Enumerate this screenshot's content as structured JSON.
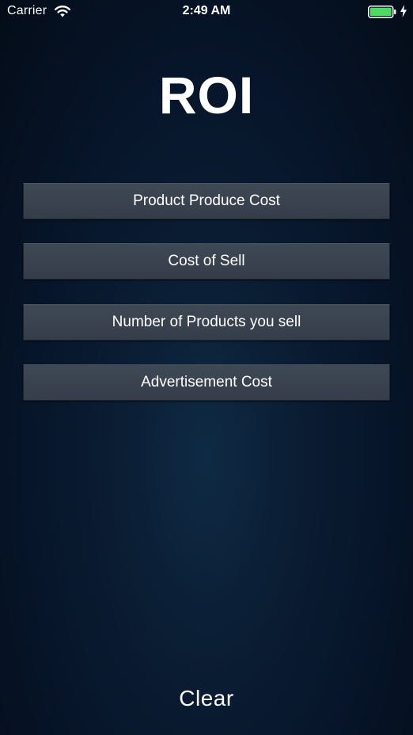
{
  "status_bar": {
    "carrier": "Carrier",
    "time": "2:49 AM",
    "wifi_icon": "wifi-icon",
    "battery_icon": "battery-icon",
    "charging_icon": "charging-bolt-icon",
    "battery_color": "#4cd964"
  },
  "title": "ROI",
  "fields": [
    {
      "label": "Product Produce Cost"
    },
    {
      "label": "Cost of Sell"
    },
    {
      "label": "Number of Products you sell"
    },
    {
      "label": "Advertisement Cost"
    }
  ],
  "clear_label": "Clear",
  "colors": {
    "background": "#07152a",
    "button_bg": "#3a4450",
    "text": "#ffffff"
  }
}
